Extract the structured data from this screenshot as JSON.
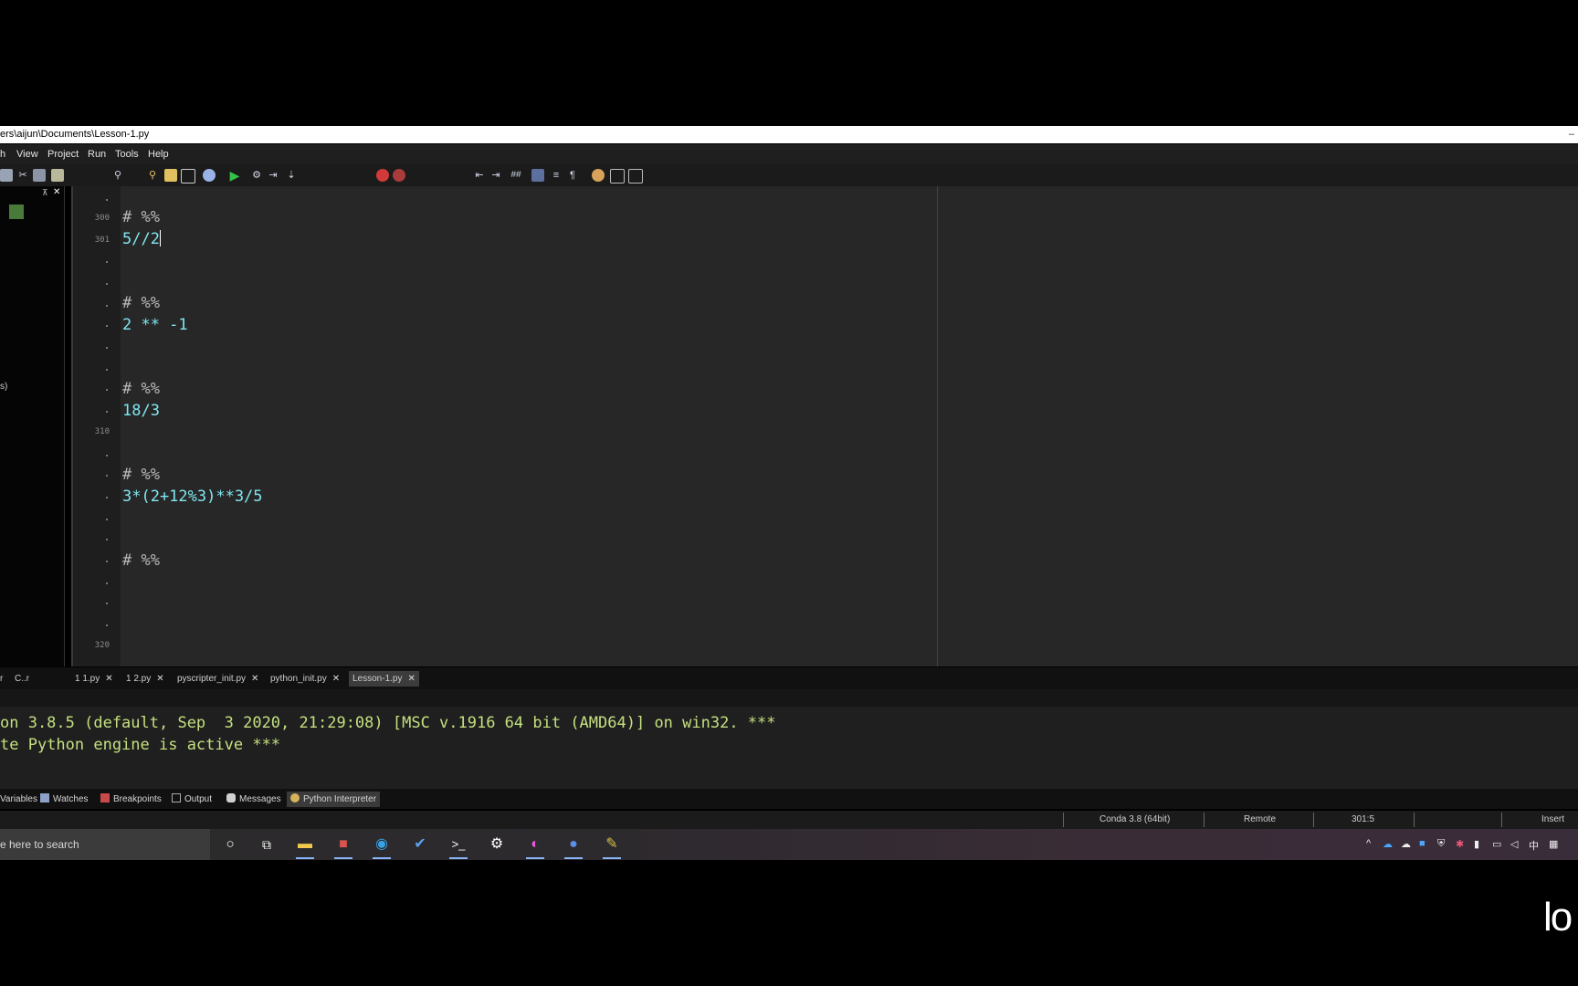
{
  "window": {
    "title": "ers\\aijun\\Documents\\Lesson-1.py",
    "minimize_glyph": "–"
  },
  "menu": [
    "h",
    "View",
    "Project",
    "Run",
    "Tools",
    "Help"
  ],
  "editor": {
    "line_numbers": [
      "300",
      "301",
      "310",
      "320"
    ],
    "code": [
      {
        "text": "# %%",
        "kind": "comment"
      },
      {
        "text": "5//2",
        "kind": "number"
      },
      {
        "text": "# %%",
        "kind": "comment"
      },
      {
        "text": "2 ** -1",
        "kind": "number"
      },
      {
        "text": "# %%",
        "kind": "comment"
      },
      {
        "text": "18/3",
        "kind": "number"
      },
      {
        "text": "# %%",
        "kind": "comment"
      },
      {
        "text": "3*(2+12%3)**3/5",
        "kind": "number"
      },
      {
        "text": "# %%",
        "kind": "comment"
      }
    ]
  },
  "left_panel": {
    "partial_label": "s)",
    "bottom_tabs": [
      "r",
      "C..r"
    ]
  },
  "file_tabs": [
    {
      "label": "1 1.py",
      "active": false
    },
    {
      "label": "1 2.py",
      "active": false
    },
    {
      "label": "pyscripter_init.py",
      "active": false
    },
    {
      "label": "python_init.py",
      "active": false
    },
    {
      "label": "Lesson-1.py",
      "active": true
    }
  ],
  "close_glyph": "✕",
  "console": {
    "lines": [
      "on 3.8.5 (default, Sep  3 2020, 21:29:08) [MSC v.1916 64 bit (AMD64)] on win32. ***",
      "te Python engine is active ***"
    ]
  },
  "bottom_tabs": [
    {
      "label": "Variables",
      "active": false
    },
    {
      "label": "Watches",
      "active": false
    },
    {
      "label": "Breakpoints",
      "active": false
    },
    {
      "label": "Output",
      "active": false
    },
    {
      "label": "Messages",
      "active": false
    },
    {
      "label": "Python Interpreter",
      "active": true
    }
  ],
  "status": {
    "interpreter": "Conda 3.8 (64bit)",
    "engine": "Remote",
    "position": "301:5",
    "mode": "Insert"
  },
  "taskbar": {
    "search_placeholder": "e here to search",
    "tray_ime": "中"
  },
  "watermark": "lo"
}
